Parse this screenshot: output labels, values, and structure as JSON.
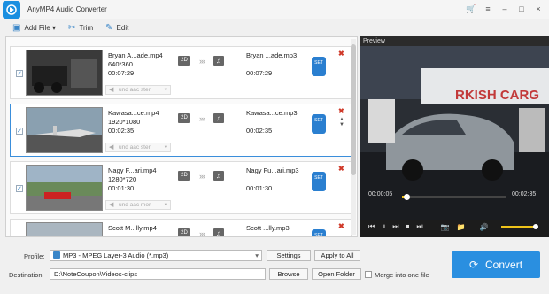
{
  "app": {
    "title": "AnyMP4 Audio Converter"
  },
  "window_controls": {
    "cart": "🛒",
    "menu": "≡",
    "minimize": "–",
    "maximize": "□",
    "close": "×"
  },
  "toolbar": {
    "add_file": "Add File ▾",
    "trim": "Trim",
    "edit": "Edit"
  },
  "files": [
    {
      "name": "Bryan A...ade.mp4",
      "resolution": "640*360",
      "duration": "00:07:29",
      "output_name": "Bryan ...ade.mp3",
      "output_duration": "00:07:29",
      "audio": "und aac ster",
      "checked": true
    },
    {
      "name": "Kawasa...ce.mp4",
      "resolution": "1920*1080",
      "duration": "00:02:35",
      "output_name": "Kawasa...ce.mp3",
      "output_duration": "00:02:35",
      "audio": "und aac ster",
      "checked": true
    },
    {
      "name": "Nagy F...ari.mp4",
      "resolution": "1280*720",
      "duration": "00:01:30",
      "output_name": "Nagy Fu...ari.mp3",
      "output_duration": "00:01:30",
      "audio": "und aac mor",
      "checked": true
    },
    {
      "name": "Scott M...lly.mp4",
      "resolution": "",
      "duration": "",
      "output_name": "Scott ...lly.mp3",
      "output_duration": "",
      "audio": "",
      "checked": false
    }
  ],
  "badge_2d": "2D",
  "settings_badge": "SET",
  "preview": {
    "title": "Preview",
    "video_text": "RKISH CARG",
    "current_time": "00:00:05",
    "total_time": "00:02:35",
    "progress": 0.04,
    "volume": 0.9
  },
  "bottom": {
    "profile_label": "Profile:",
    "profile_value": "MP3 - MPEG Layer-3 Audio (*.mp3)",
    "settings_button": "Settings",
    "apply_all_button": "Apply to All",
    "destination_label": "Destination:",
    "destination_value": "D:\\NoteCoupon\\Videos-clips",
    "browse_button": "Browse",
    "open_folder_button": "Open Folder",
    "merge_label": "Merge into one file",
    "convert_button": "Convert"
  },
  "colors": {
    "accent": "#2a8fe0",
    "progress": "#f0c419",
    "close_red": "#d03a2a"
  }
}
